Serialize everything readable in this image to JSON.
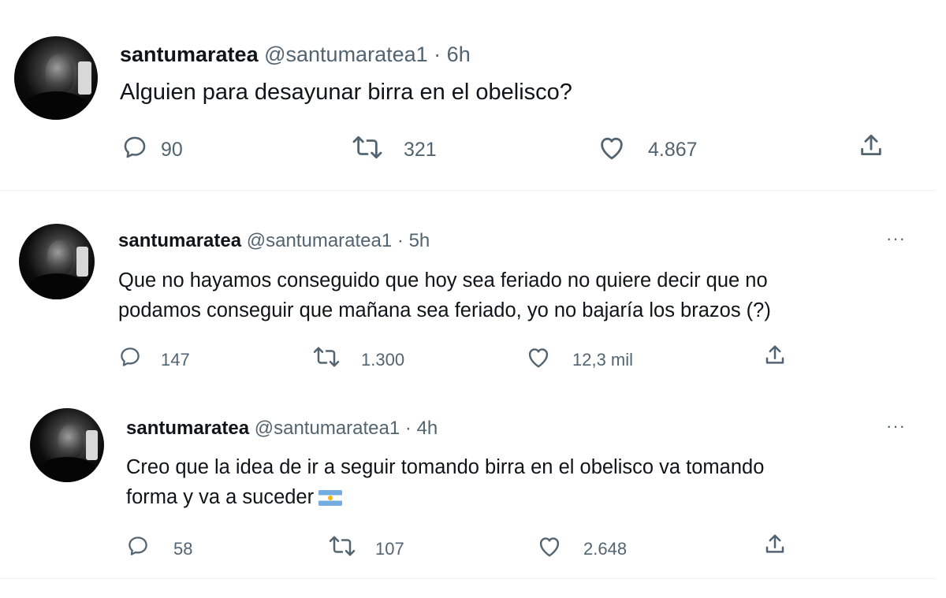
{
  "tweets": [
    {
      "name": "santumaratea",
      "handle": "@santumaratea1",
      "separator": "·",
      "time": "6h",
      "text": "Alguien para desayunar birra en el obelisco?",
      "replies": "90",
      "retweets": "321",
      "likes": "4.867"
    },
    {
      "name": "santumaratea",
      "handle": "@santumaratea1",
      "separator": "·",
      "time": "5h",
      "more": "···",
      "text_line1": "Que no hayamos conseguido que hoy sea feriado no quiere decir que no",
      "text_line2": "podamos conseguir que mañana sea feriado, yo no bajaría los brazos (?)",
      "replies": "147",
      "retweets": "1.300",
      "likes": "12,3 mil"
    },
    {
      "name": "santumaratea",
      "handle": "@santumaratea1",
      "separator": "·",
      "time": "4h",
      "more": "···",
      "text_line1": "Creo que la idea de ir a seguir tomando birra en el obelisco va tomando",
      "text_line2": "forma y va a suceder",
      "emoji": "argentina-flag-emoji",
      "replies": "58",
      "retweets": "107",
      "likes": "2.648"
    }
  ],
  "icons": {
    "reply": "reply-icon",
    "retweet": "retweet-icon",
    "like": "heart-icon",
    "share": "share-icon"
  },
  "colors": {
    "text": "#0f1419",
    "secondary": "#536471",
    "divider": "#eff3f4",
    "flag_blue": "#74acdf",
    "flag_sun": "#f6b40e"
  }
}
